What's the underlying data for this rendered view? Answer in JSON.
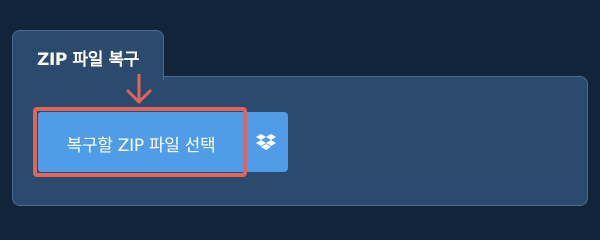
{
  "panel": {
    "tab_label": "ZIP 파일 복구"
  },
  "actions": {
    "select_zip_label": "복구할 ZIP 파일 선택",
    "dropbox_icon": "dropbox-icon",
    "annotation_icon": "arrow-down-icon"
  },
  "colors": {
    "background": "#12243a",
    "panel": "#2b4a6d",
    "button": "#4f9de8",
    "highlight": "#e0645a"
  }
}
